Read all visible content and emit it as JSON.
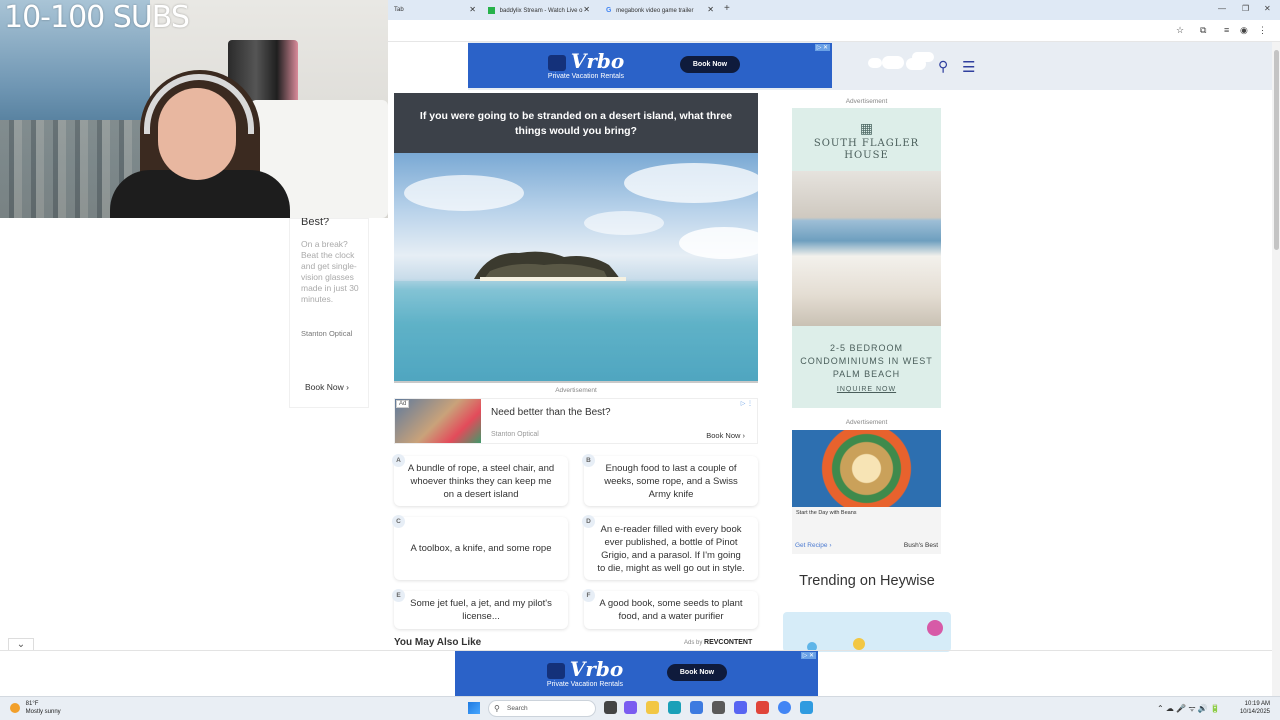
{
  "stream_overlay": {
    "subs_label": "10-100 SUBS"
  },
  "browser": {
    "tabs": [
      {
        "label": "Tab",
        "active": true
      },
      {
        "label": "baddylix Stream - Watch Live o",
        "active": false
      },
      {
        "label": "megabonk video game trailer",
        "active": false
      }
    ]
  },
  "ads": {
    "ad_label": "Advertisement",
    "vrbo": {
      "logo": "Vrbo",
      "tagline": "Private Vacation Rentals",
      "cta": "Book Now"
    },
    "native": {
      "badge": "Ad",
      "headline": "Need better than the Best?",
      "brand": "Stanton Optical",
      "cta": "Book Now"
    },
    "left_remnant": {
      "headline": "Best?",
      "body": "On a break? Beat the clock and get single-vision glasses made in just 30 minutes.",
      "brand": "Stanton Optical",
      "cta": "Book Now"
    },
    "flagler": {
      "name": "SOUTH FLAGLER HOUSE",
      "copy": "2-5 BEDROOM CONDOMINIUMS IN WEST PALM BEACH",
      "link": "INQUIRE NOW"
    },
    "beans": {
      "caption": "Start the Day with Beans",
      "cta": "Get Recipe",
      "brand": "Bush's Best"
    }
  },
  "quiz": {
    "question": "If you were going to be stranded on a desert island, what three things would you bring?",
    "answers": [
      {
        "letter": "A",
        "text": "A bundle of rope, a steel chair, and whoever thinks they can keep me on a desert island"
      },
      {
        "letter": "B",
        "text": "Enough food to last a couple of weeks, some rope, and a Swiss Army knife"
      },
      {
        "letter": "C",
        "text": "A toolbox, a knife, and some rope"
      },
      {
        "letter": "D",
        "text": "An e-reader filled with every book ever published, a bottle of Pinot Grigio, and a parasol. If I'm going to die, might as well go out in style."
      },
      {
        "letter": "E",
        "text": "Some jet fuel, a jet, and my pilot's license..."
      },
      {
        "letter": "F",
        "text": "A good book, some seeds to plant food, and a water purifier"
      }
    ]
  },
  "recommendations": {
    "title": "You May Also Like",
    "by_prefix": "Ads by",
    "by_brand": "REVCONTENT"
  },
  "sidebar": {
    "trending_title": "Trending on Heywise"
  },
  "taskbar": {
    "weather_temp": "81°F",
    "weather_desc": "Mostly sunny",
    "search_placeholder": "Search",
    "time": "10:19 AM",
    "date": "10/14/2025"
  }
}
